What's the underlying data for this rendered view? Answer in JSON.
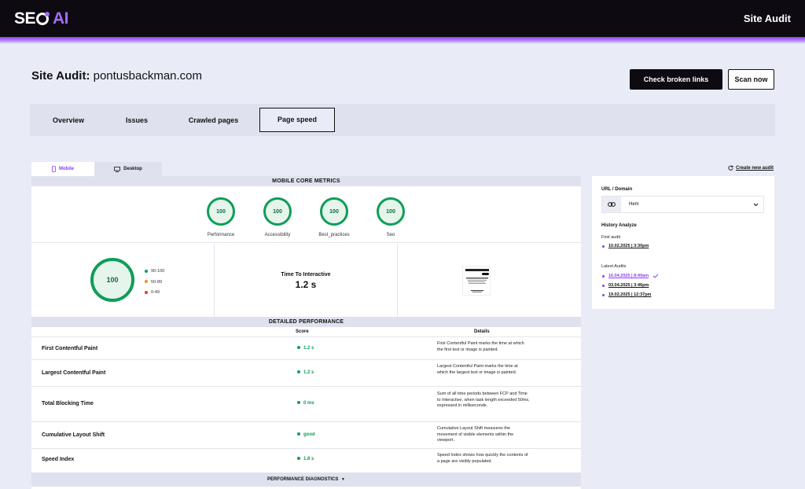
{
  "header": {
    "logo_part1": "SE",
    "logo_part2": "AI",
    "title": "Site Audit"
  },
  "page": {
    "title_prefix": "Site Audit:",
    "domain": "pontusbackman.com",
    "check_links_label": "Check broken links",
    "scan_label": "Scan now"
  },
  "tabs": [
    {
      "label": "Overview"
    },
    {
      "label": "Issues"
    },
    {
      "label": "Crawled pages"
    },
    {
      "label": "Page speed",
      "active": true
    }
  ],
  "device": {
    "mobile_label": "Mobile",
    "desktop_label": "Desktop",
    "selected": "Mobile"
  },
  "create_audit_label": "Create new audit",
  "core_metrics": {
    "heading": "MOBILE CORE METRICS",
    "metrics": [
      {
        "label": "Performance",
        "score": "100"
      },
      {
        "label": "Accessibility",
        "score": "100"
      },
      {
        "label": "Best_practices",
        "score": "100"
      },
      {
        "label": "Seo",
        "score": "100"
      }
    ],
    "overall_score": "100",
    "legend": [
      {
        "label": "90-100",
        "color": "#0f9d58"
      },
      {
        "label": "50-89",
        "color": "#f28c28"
      },
      {
        "label": "0-49",
        "color": "#e53935"
      }
    ],
    "tti_label": "Time To Interactive",
    "tti_value": "1.2 s"
  },
  "detailed": {
    "heading": "DETAILED PERFORMANCE",
    "col_score": "Score",
    "col_details": "Details",
    "rows": [
      {
        "name": "First Contentful Paint",
        "score": "1.2 s",
        "details": "First Contentful Paint marks the time at which the first text or image is painted."
      },
      {
        "name": "Largest Contentful Paint",
        "score": "1.2 s",
        "details": "Largest Contentful Paint marks the time at which the largest text or image is painted."
      },
      {
        "name": "Total Blocking Time",
        "score": "0 ms",
        "details": "Sum of all time periods between FCP and Time to Interactive, when task length exceeded 50ms, expressed in milliseconds."
      },
      {
        "name": "Cumulative Layout Shift",
        "score": "good",
        "details": "Cumulative Layout Shift measures the movement of visible elements within the viewport."
      },
      {
        "name": "Speed Index",
        "score": "1.8 s",
        "details": "Speed Index shows how quickly the contents of a page are visibly populated."
      }
    ],
    "diagnostics_label": "PERFORMANCE DIAGNOSTICS"
  },
  "side": {
    "url_label": "URL / Domain",
    "url_value": "Hem",
    "history_label": "History Analyze",
    "first_audit_label": "First audit",
    "first_audit_date": "10.02.2025 | 3:30pm",
    "latest_label": "Latest Audits",
    "latest": [
      {
        "date": "16.04.2025 | 8:40am",
        "active": true
      },
      {
        "date": "03.04.2025 | 3:46pm"
      },
      {
        "date": "19.02.2025 | 12:37pm"
      }
    ]
  },
  "colors": {
    "accent": "#8a3df5",
    "good": "#0f9d58",
    "dark": "#0d0a12"
  }
}
